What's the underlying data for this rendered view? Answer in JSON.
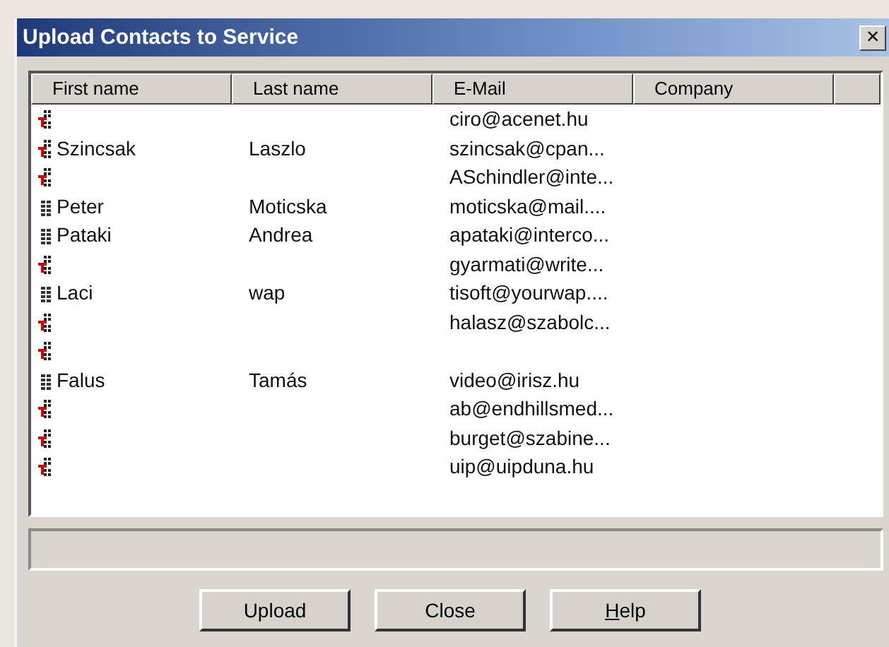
{
  "window": {
    "title": "Upload Contacts to Service",
    "close": "×"
  },
  "table": {
    "columns": [
      "First name",
      "Last name",
      "E-Mail",
      "Company"
    ],
    "rows": [
      {
        "kind": "group",
        "first_name": "",
        "last_name": "",
        "email": "ciro@acenet.hu"
      },
      {
        "kind": "group",
        "first_name": "Szincsak",
        "last_name": "Laszlo",
        "email": "szincsak@cpan..."
      },
      {
        "kind": "group",
        "first_name": "",
        "last_name": "",
        "email": "ASchindler@inte..."
      },
      {
        "kind": "contact",
        "first_name": "Peter",
        "last_name": "Moticska",
        "email": "moticska@mail...."
      },
      {
        "kind": "contact",
        "first_name": "Pataki",
        "last_name": "Andrea",
        "email": "apataki@interco..."
      },
      {
        "kind": "group",
        "first_name": "",
        "last_name": "",
        "email": "gyarmati@write..."
      },
      {
        "kind": "contact",
        "first_name": "Laci",
        "last_name": "wap",
        "email": "tisoft@yourwap...."
      },
      {
        "kind": "group",
        "first_name": "",
        "last_name": "",
        "email": "halasz@szabolc..."
      },
      {
        "kind": "group",
        "first_name": "",
        "last_name": "",
        "email": ""
      },
      {
        "kind": "contact",
        "first_name": "Falus",
        "last_name": "Tamás",
        "email": "video@irisz.hu"
      },
      {
        "kind": "group",
        "first_name": "",
        "last_name": "",
        "email": "ab@endhillsmed..."
      },
      {
        "kind": "group",
        "first_name": "",
        "last_name": "",
        "email": "burget@szabine..."
      },
      {
        "kind": "group",
        "first_name": "",
        "last_name": "",
        "email": "uip@uipduna.hu"
      }
    ]
  },
  "buttons": [
    {
      "label": "Upload",
      "underline_first": false
    },
    {
      "label": "Close",
      "underline_first": false
    },
    {
      "label": "Help",
      "underline_first": true
    }
  ]
}
